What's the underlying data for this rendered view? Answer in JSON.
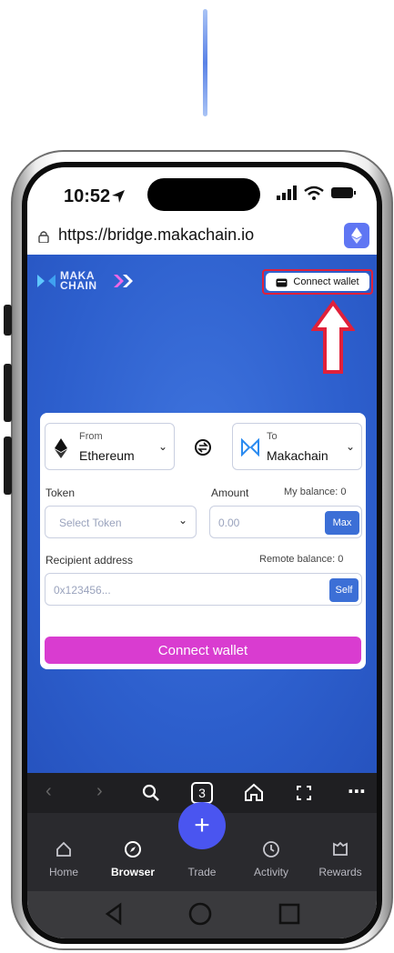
{
  "status": {
    "time": "10:52"
  },
  "browser": {
    "url": "https://bridge.makachain.io"
  },
  "brand": {
    "logo_line1": "MAKA",
    "logo_line2": "CHAIN"
  },
  "header": {
    "connect_wallet_label": "Connect wallet"
  },
  "bridge": {
    "from_label": "From",
    "from_network": "Ethereum",
    "to_label": "To",
    "to_network": "Makachain",
    "token_label": "Token",
    "token_placeholder": "Select Token",
    "amount_label": "Amount",
    "my_balance": "My balance: 0",
    "amount_placeholder": "0.00",
    "max_label": "Max",
    "recipient_label": "Recipient address",
    "remote_balance": "Remote balance: 0",
    "recipient_placeholder": "0x123456...",
    "self_label": "Self",
    "connect_button": "Connect wallet"
  },
  "navbar": {
    "tab_count": "3"
  },
  "tabs": [
    {
      "label": "Home",
      "icon": "home-icon"
    },
    {
      "label": "Browser",
      "icon": "compass-icon"
    },
    {
      "label": "Trade",
      "icon": "plus-icon"
    },
    {
      "label": "Activity",
      "icon": "clock-icon"
    },
    {
      "label": "Rewards",
      "icon": "gift-icon"
    }
  ],
  "colors": {
    "dapp_bg": "#2d5fcd",
    "connect_button": "#d93cd0",
    "highlight": "#e0203a",
    "fab": "#4a55f0"
  }
}
